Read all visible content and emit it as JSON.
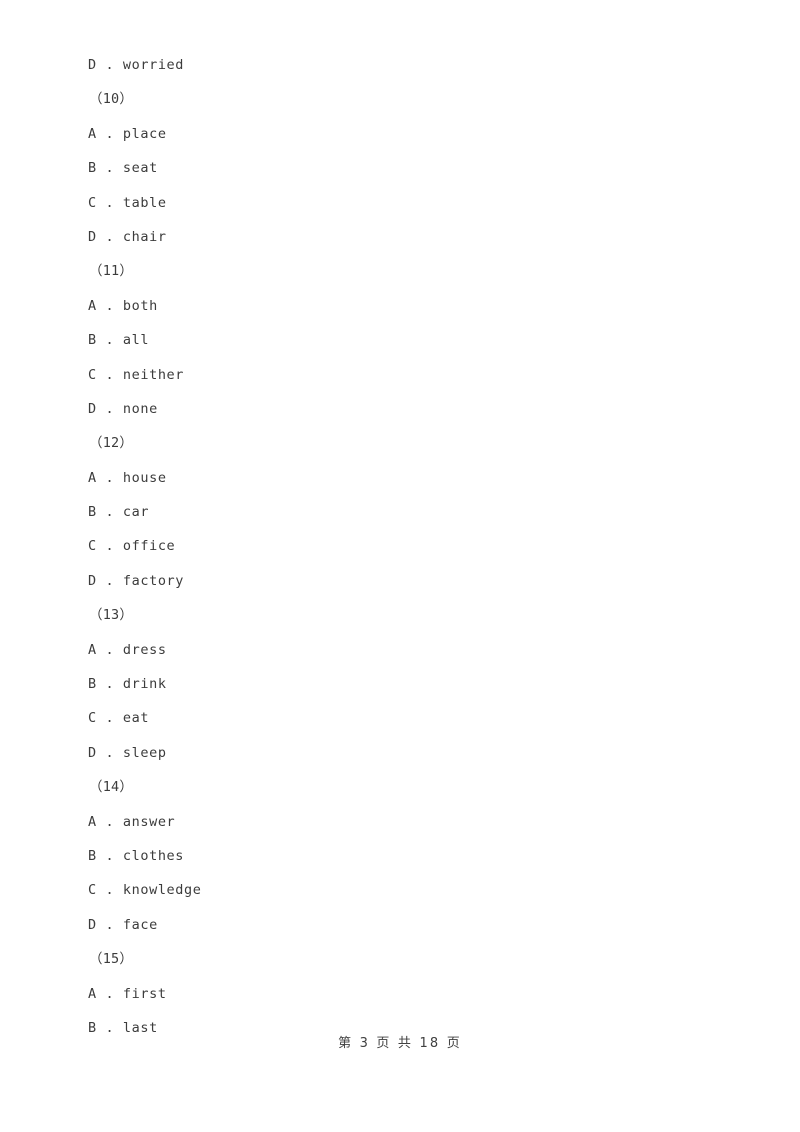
{
  "document": {
    "page_label": "第 3 页 共 18 页",
    "current_page": "3",
    "total_pages": "18",
    "text_color": "#3c3c3c",
    "background_color": "#ffffff"
  },
  "lines": [
    {
      "type": "option",
      "text": "D . worried"
    },
    {
      "type": "qnum",
      "text": "（10）"
    },
    {
      "type": "option",
      "text": "A . place"
    },
    {
      "type": "option",
      "text": "B . seat"
    },
    {
      "type": "option",
      "text": "C . table"
    },
    {
      "type": "option",
      "text": "D . chair"
    },
    {
      "type": "qnum",
      "text": "（11）"
    },
    {
      "type": "option",
      "text": "A . both"
    },
    {
      "type": "option",
      "text": "B . all"
    },
    {
      "type": "option",
      "text": "C . neither"
    },
    {
      "type": "option",
      "text": "D . none"
    },
    {
      "type": "qnum",
      "text": "（12）"
    },
    {
      "type": "option",
      "text": "A . house"
    },
    {
      "type": "option",
      "text": "B . car"
    },
    {
      "type": "option",
      "text": "C . office"
    },
    {
      "type": "option",
      "text": "D . factory"
    },
    {
      "type": "qnum",
      "text": "（13）"
    },
    {
      "type": "option",
      "text": "A . dress"
    },
    {
      "type": "option",
      "text": "B . drink"
    },
    {
      "type": "option",
      "text": "C . eat"
    },
    {
      "type": "option",
      "text": "D . sleep"
    },
    {
      "type": "qnum",
      "text": "（14）"
    },
    {
      "type": "option",
      "text": "A . answer"
    },
    {
      "type": "option",
      "text": "B . clothes"
    },
    {
      "type": "option",
      "text": "C . knowledge"
    },
    {
      "type": "option",
      "text": "D . face"
    },
    {
      "type": "qnum",
      "text": "（15）"
    },
    {
      "type": "option",
      "text": "A . first"
    },
    {
      "type": "option",
      "text": "B . last"
    }
  ]
}
